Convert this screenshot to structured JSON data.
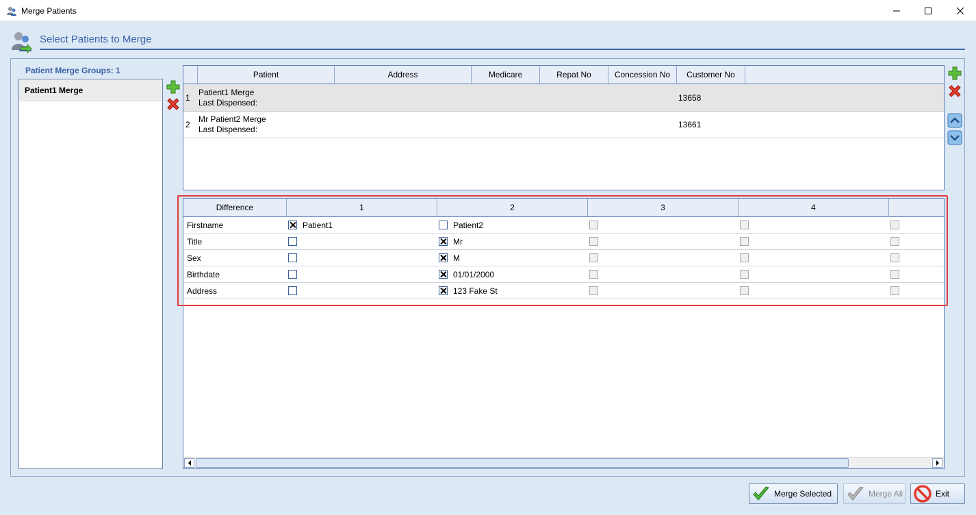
{
  "window": {
    "title": "Merge Patients"
  },
  "header": {
    "title": "Select Patients to Merge"
  },
  "groups": {
    "label": "Patient Merge Groups: 1",
    "items": [
      "Patient1 Merge"
    ]
  },
  "patients_grid": {
    "columns": [
      "Patient",
      "Address",
      "Medicare",
      "Repat No",
      "Concession No",
      "Customer No"
    ],
    "rows": [
      {
        "index": "1",
        "name": "Patient1 Merge",
        "last_dispensed": "Last Dispensed:",
        "customer_no": "13658"
      },
      {
        "index": "2",
        "name": "Mr Patient2 Merge",
        "last_dispensed": "Last Dispensed:",
        "customer_no": "13661"
      }
    ]
  },
  "difference_grid": {
    "columns": [
      "Difference",
      "1",
      "2",
      "3",
      "4"
    ],
    "rows": [
      {
        "field": "Firstname",
        "c1_checked": true,
        "c1_value": "Patient1",
        "c2_checked": false,
        "c2_value": "Patient2"
      },
      {
        "field": "Title",
        "c1_checked": false,
        "c1_value": "",
        "c2_checked": true,
        "c2_value": "Mr"
      },
      {
        "field": "Sex",
        "c1_checked": false,
        "c1_value": "",
        "c2_checked": true,
        "c2_value": "M"
      },
      {
        "field": "Birthdate",
        "c1_checked": false,
        "c1_value": "",
        "c2_checked": true,
        "c2_value": "01/01/2000"
      },
      {
        "field": "Address",
        "c1_checked": false,
        "c1_value": "",
        "c2_checked": true,
        "c2_value": "123 Fake St"
      }
    ]
  },
  "buttons": {
    "merge_selected": "Merge Selected",
    "merge_all": "Merge All",
    "exit": "Exit"
  },
  "colors": {
    "accent": "#3b63a8",
    "highlight_border": "#e0393e",
    "background": "#dde8f5"
  }
}
